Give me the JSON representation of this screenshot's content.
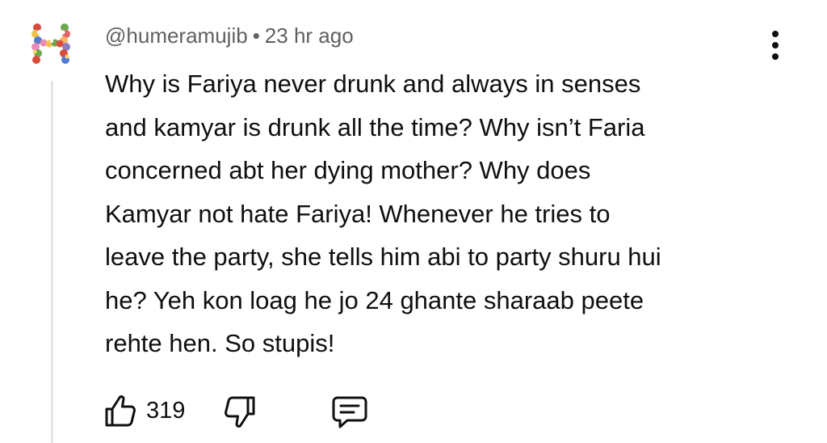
{
  "comment": {
    "author": "@humeramujib",
    "separator": "•",
    "timestamp": "23 hr ago",
    "avatar_letter": "H",
    "text_lines": [
      "Why is Fariya never drunk and always in senses",
      "and kamyar is drunk all the time? Why isn’t Faria",
      "concerned abt her dying mother? Why does",
      "Kamyar not hate Fariya! Whenever he tries to",
      "leave the party, she tells him abi to party shuru hui",
      "he? Yeh kon loag he jo 24 ghante sharaab peete",
      "rehte hen. So stupis!"
    ],
    "like_count": "319"
  },
  "icons": {
    "avatar": "floral-letter-h-avatar",
    "menu": "more-vert-icon",
    "like": "thumbs-up-icon",
    "dislike": "thumbs-down-icon",
    "reply": "comment-reply-icon"
  },
  "colors": {
    "text_primary": "#0f0f0f",
    "text_secondary": "#606060",
    "thread_line": "#e5e5e5",
    "background": "#ffffff"
  }
}
